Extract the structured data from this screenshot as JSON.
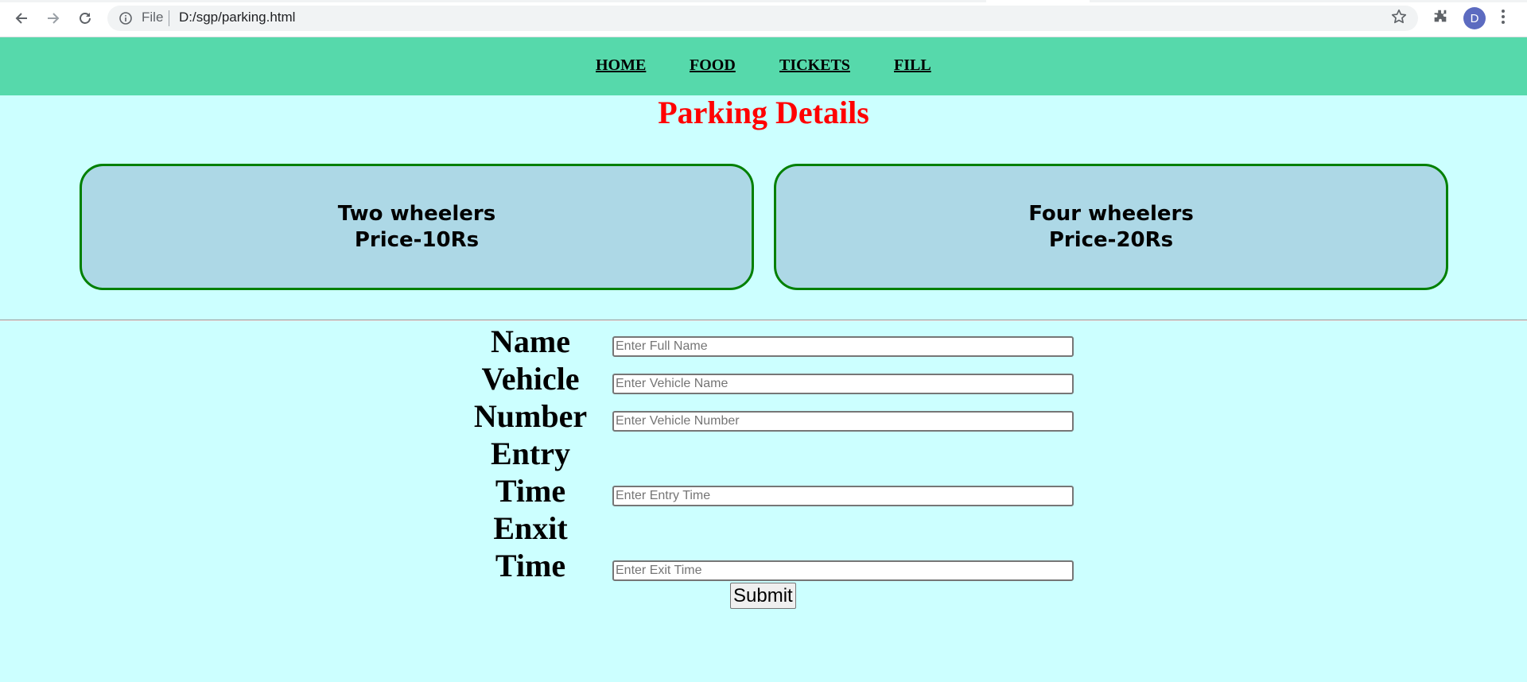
{
  "browser": {
    "scheme": "File",
    "url": "D:/sgp/parking.html",
    "profile_initial": "D",
    "icons": [
      "back-icon",
      "forward-icon",
      "reload-icon",
      "info-icon",
      "star-icon",
      "extensions-icon",
      "menu-kebab-icon"
    ]
  },
  "nav": {
    "items": [
      "HOME",
      "FOOD",
      "TICKETS",
      "FILL"
    ]
  },
  "page": {
    "title": "Parking Details"
  },
  "cards": [
    {
      "line1": "Two wheelers",
      "line2": "Price-10Rs"
    },
    {
      "line1": "Four wheelers",
      "line2": "Price-20Rs"
    }
  ],
  "form": {
    "labels": {
      "name": "Name",
      "vehicle": "Vehicle",
      "number": "Number",
      "entry1": "Entry",
      "entry2": "Time",
      "exit1": "Enxit",
      "exit2": "Time"
    },
    "placeholders": {
      "name": "Enter Full Name",
      "vehicle": "Enter Vehicle Name",
      "number": "Enter Vehicle Number",
      "entry": "Enter Entry Time",
      "exit": "Enter Exit Time"
    },
    "submit": "Submit"
  },
  "colors": {
    "nav_bg": "#56d9ab",
    "page_bg": "#ccffff",
    "title": "#ff0000",
    "card_bg": "#add8e6",
    "card_border": "#008000"
  }
}
